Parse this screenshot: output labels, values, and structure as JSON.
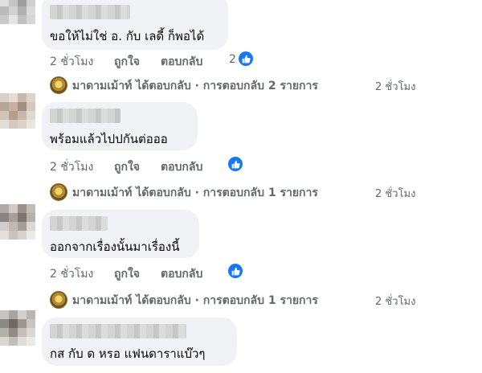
{
  "comments": [
    {
      "text": "ขอให้ไม่ใช่ อ. กับ เลดี้ ก็พอได้",
      "time": "2 ชั่วโมง",
      "like_label": "ถูกใจ",
      "reply_label": "ตอบกลับ",
      "reaction_count": "2",
      "reply_summary": "มาดามเม้าท์ ได้ตอบกลับ · การตอบกลับ 2 รายการ",
      "reply_time": "2 ชั่วโมง"
    },
    {
      "text": "พร้อมแล้วไปปกันต่อออ",
      "time": "2 ชั่วโมง",
      "like_label": "ถูกใจ",
      "reply_label": "ตอบกลับ",
      "reply_summary": "มาดามเม้าท์ ได้ตอบกลับ · การตอบกลับ 1 รายการ",
      "reply_time": "2 ชั่วโมง"
    },
    {
      "text": "ออกจากเรื่องนั้นมาเรื่องนี้",
      "time": "2 ชั่วโมง",
      "like_label": "ถูกใจ",
      "reply_label": "ตอบกลับ",
      "reply_summary": "มาดามเม้าท์ ได้ตอบกลับ · การตอบกลับ 1 รายการ",
      "reply_time": "2 ชั่วโมง"
    },
    {
      "text": "กส กับ ด หรอ แฟนดาราแบ๊วๆ"
    }
  ],
  "colors": {
    "like_blue": "#1877f2",
    "bubble": "#f0f2f5",
    "meta_text": "#65676b"
  }
}
